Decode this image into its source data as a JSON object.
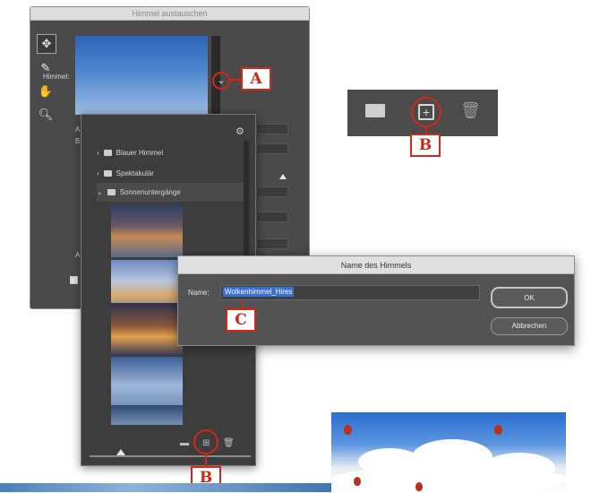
{
  "main_dialog": {
    "title": "Himmel austauschen",
    "sky_label": "Himmel:",
    "row_letters": [
      "A",
      "B"
    ],
    "bottom_letter": "A"
  },
  "sky_panel": {
    "folders": [
      {
        "label": "Blauer Himmel",
        "expanded": false
      },
      {
        "label": "Spektakulär",
        "expanded": false
      },
      {
        "label": "Sonnenuntergänge",
        "expanded": true
      }
    ],
    "icons": {
      "settings": "gear-icon",
      "new_folder": "folder-icon",
      "new_sky": "plus-square-icon",
      "delete": "trash-icon"
    }
  },
  "name_dialog": {
    "title": "Name des Himmels",
    "name_label": "Name:",
    "name_value": "Wolkenhimmel_Hires",
    "ok_label": "OK",
    "cancel_label": "Abbrechen"
  },
  "callouts": {
    "a": "A",
    "b_top": "B",
    "c": "C",
    "b_bottom": "B"
  },
  "colors": {
    "callout_red": "#d0291c",
    "dialog_bg": "#4a4a4a",
    "selection_blue": "#3d6fd0"
  }
}
